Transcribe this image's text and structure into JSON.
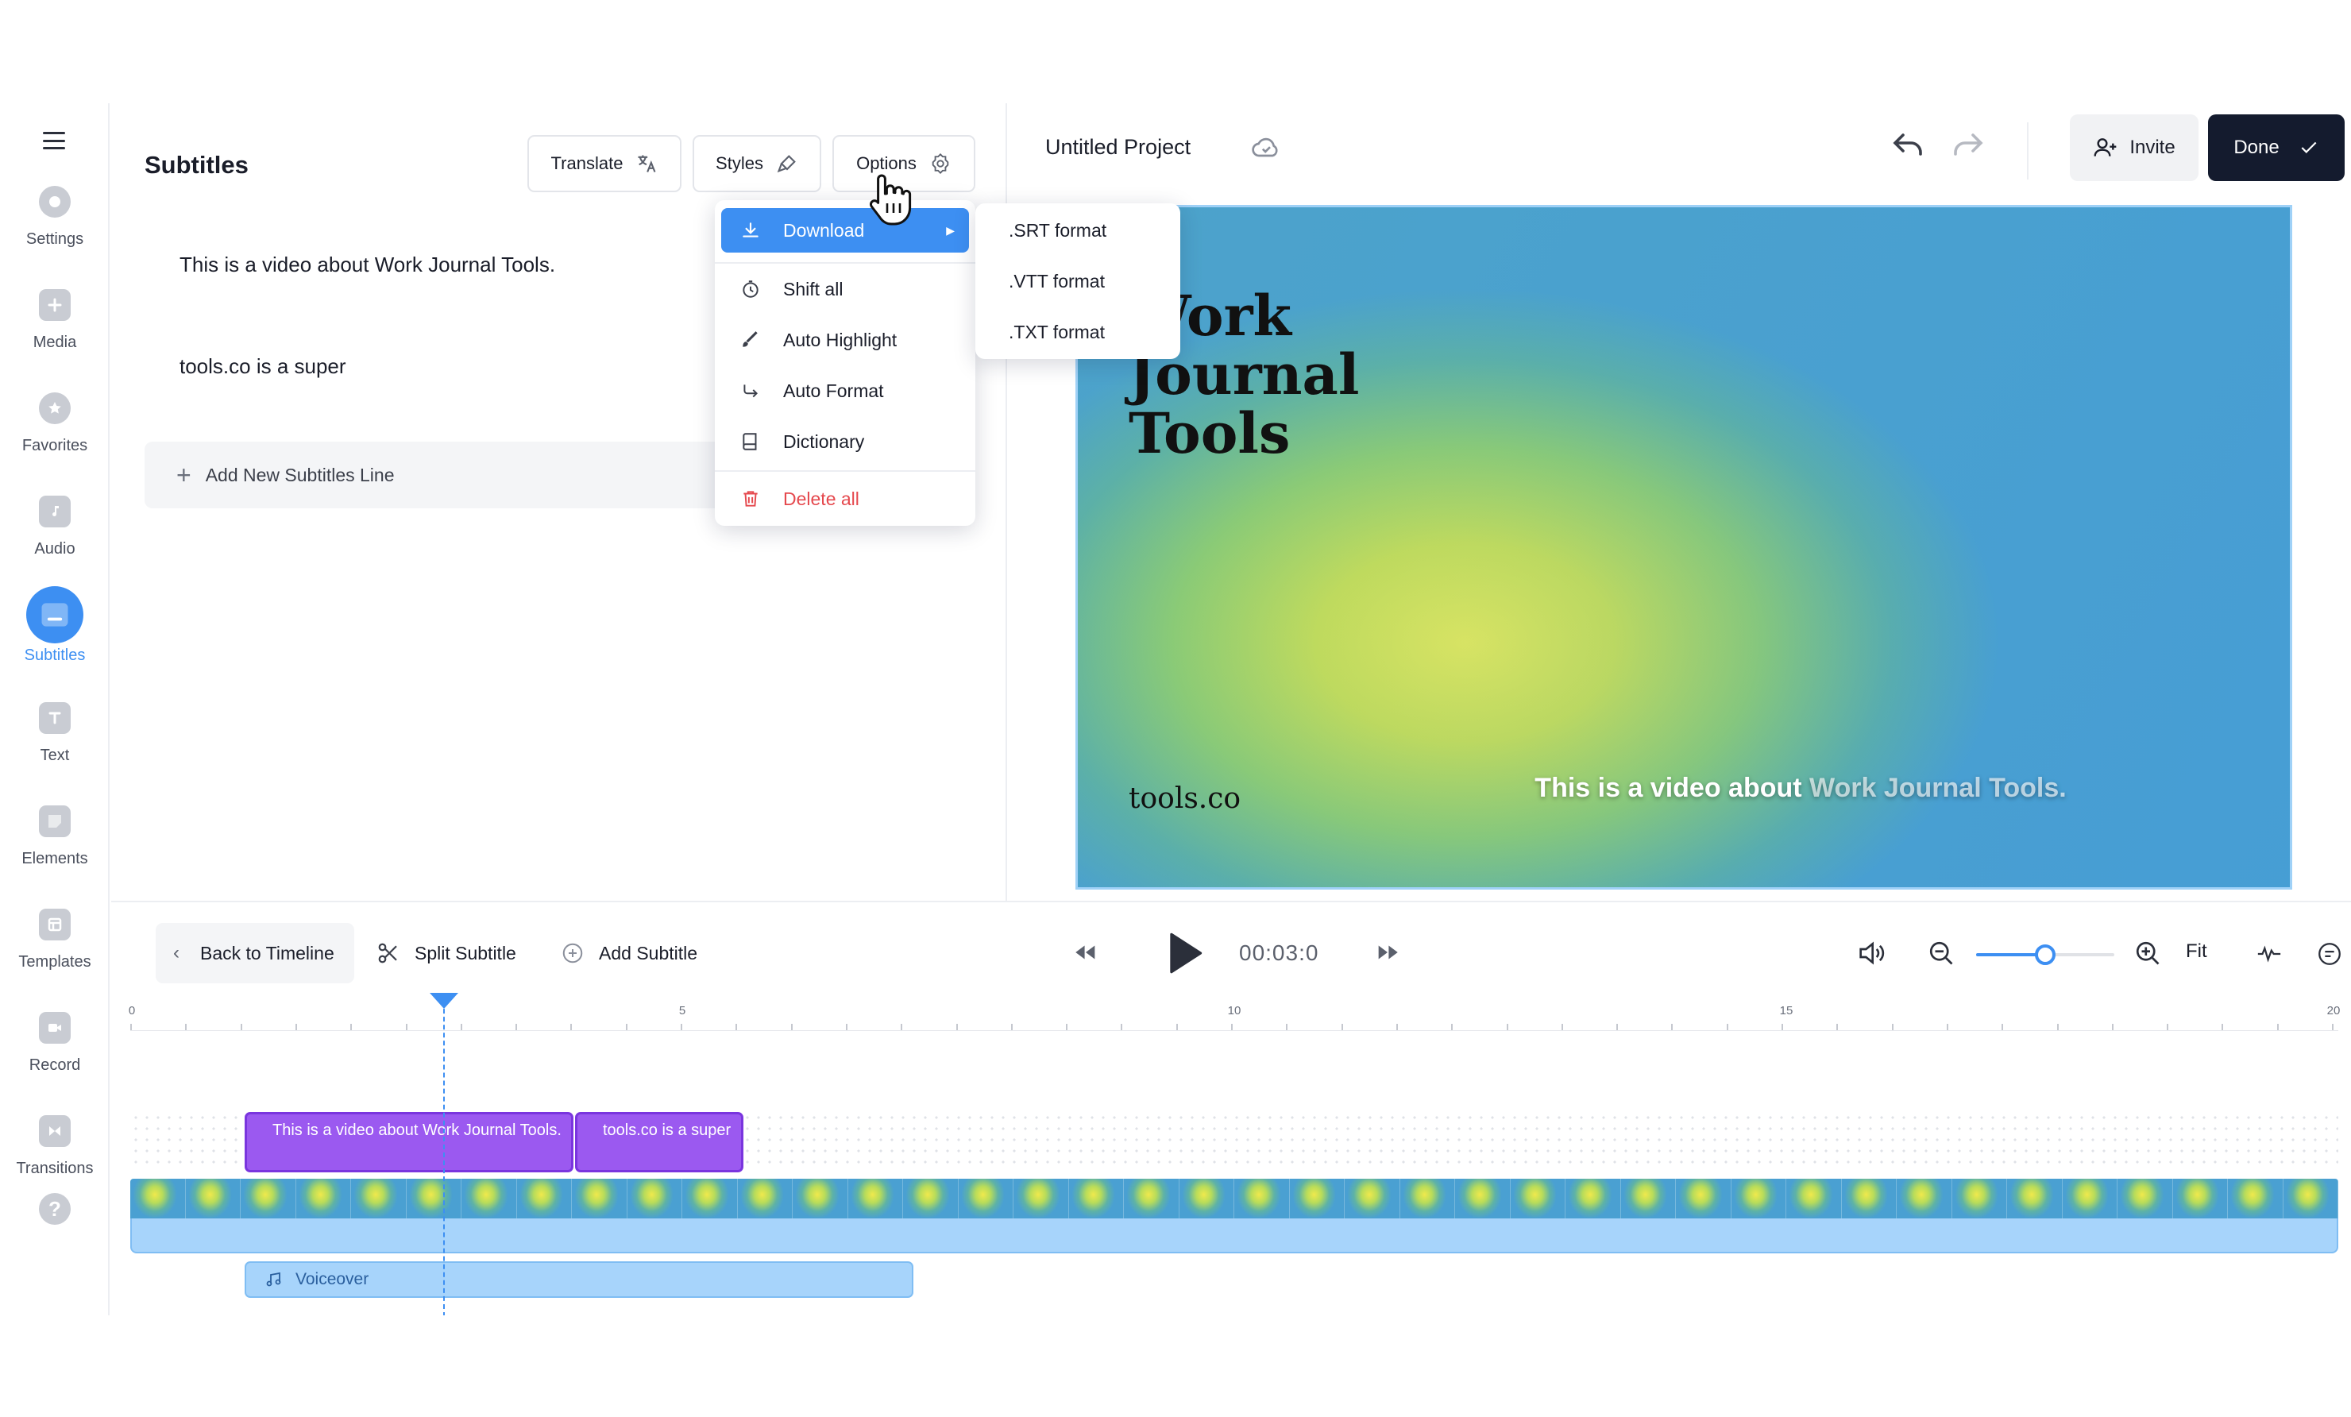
{
  "sidebar": {
    "items": [
      {
        "label": "Settings",
        "icon": "settings-icon"
      },
      {
        "label": "Media",
        "icon": "plus-icon"
      },
      {
        "label": "Favorites",
        "icon": "star-icon"
      },
      {
        "label": "Audio",
        "icon": "music-note-icon"
      },
      {
        "label": "Subtitles",
        "icon": "subtitles-icon",
        "active": true
      },
      {
        "label": "Text",
        "icon": "text-icon"
      },
      {
        "label": "Elements",
        "icon": "elements-icon"
      },
      {
        "label": "Templates",
        "icon": "templates-icon"
      },
      {
        "label": "Record",
        "icon": "camera-icon"
      },
      {
        "label": "Transitions",
        "icon": "transitions-icon"
      }
    ],
    "help_label": "?"
  },
  "subtitles_panel": {
    "title": "Subtitles",
    "translate_label": "Translate",
    "styles_label": "Styles",
    "options_label": "Options",
    "lines": [
      "This is a video about Work Journal Tools.",
      "tools.co is a super"
    ],
    "add_line_label": "Add New Subtitles Line"
  },
  "options_menu": {
    "items": [
      {
        "label": "Download",
        "icon": "download-icon",
        "highlighted": true,
        "has_submenu": true
      },
      {
        "label": "Shift all",
        "icon": "timer-icon"
      },
      {
        "label": "Auto Highlight",
        "icon": "brush-icon"
      },
      {
        "label": "Auto Format",
        "icon": "format-arrow-icon"
      },
      {
        "label": "Dictionary",
        "icon": "book-icon"
      },
      {
        "label": "Delete all",
        "icon": "trash-icon",
        "danger": true
      }
    ],
    "download_submenu": [
      ".SRT format",
      ".VTT format",
      ".TXT format"
    ]
  },
  "header": {
    "project_title": "Untitled Project",
    "invite_label": "Invite",
    "done_label": "Done"
  },
  "canvas": {
    "title_lines": [
      "Work",
      "Journal",
      "Tools"
    ],
    "brand": "tools.co",
    "subtitle_highlight": "This is a video about ",
    "subtitle_rest": "Work Journal Tools."
  },
  "timeline": {
    "back_label": "Back to Timeline",
    "split_label": "Split Subtitle",
    "add_label": "Add Subtitle",
    "timecode": "00:03:0",
    "fit_label": "Fit",
    "zoom_level": 0.5,
    "ruler_labels": [
      "0",
      "5",
      "10",
      "15",
      "20"
    ],
    "subtitle_clips": [
      "This is a video about Work Journal Tools.",
      "tools.co is a super"
    ],
    "voiceover_label": "Voiceover"
  },
  "colors": {
    "accent": "#3d8ff2",
    "clip_purple": "#9b59f0",
    "done_bg": "#141b2e",
    "danger": "#e5484d"
  }
}
